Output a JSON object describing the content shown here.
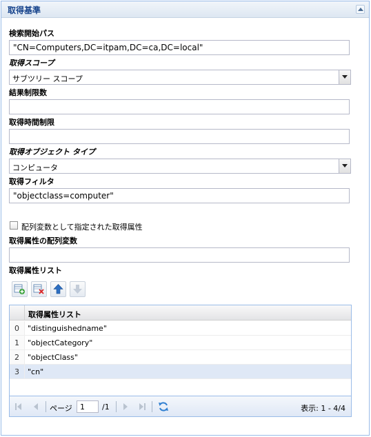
{
  "panel": {
    "title": "取得基準"
  },
  "search_path": {
    "label": "検索開始パス",
    "value": "\"CN=Computers,DC=itpam,DC=ca,DC=local\""
  },
  "scope": {
    "label": "取得スコープ",
    "value": "サブツリー スコープ"
  },
  "result_limit": {
    "label": "結果制限数",
    "value": ""
  },
  "time_limit": {
    "label": "取得時間制限",
    "value": ""
  },
  "object_type": {
    "label": "取得オブジェクト タイプ",
    "value": "コンピュータ"
  },
  "filter": {
    "label": "取得フィルタ",
    "value": "\"objectclass=computer\""
  },
  "array_checkbox": {
    "label": "配列変数として指定された取得属性",
    "checked": false
  },
  "attr_array_var": {
    "label": "取得属性の配列変数",
    "value": ""
  },
  "attr_list": {
    "label": "取得属性リスト",
    "toolbar": [
      "add-row-icon",
      "delete-row-icon",
      "move-up-icon",
      "move-down-icon"
    ],
    "column_header": "取得属性リスト",
    "rows": [
      {
        "num": "0",
        "value": "\"distinguishedname\""
      },
      {
        "num": "1",
        "value": "\"objectCategory\""
      },
      {
        "num": "2",
        "value": "\"objectClass\""
      },
      {
        "num": "3",
        "value": "\"cn\""
      }
    ],
    "selected_row": 3
  },
  "pager": {
    "page_word": "ページ",
    "page_value": "1",
    "page_total": "/1",
    "display": "表示: 1 - 4/4"
  },
  "colors": {
    "accent": "#15428b",
    "border": "#99bbe8",
    "selection": "#dfe8f6"
  }
}
